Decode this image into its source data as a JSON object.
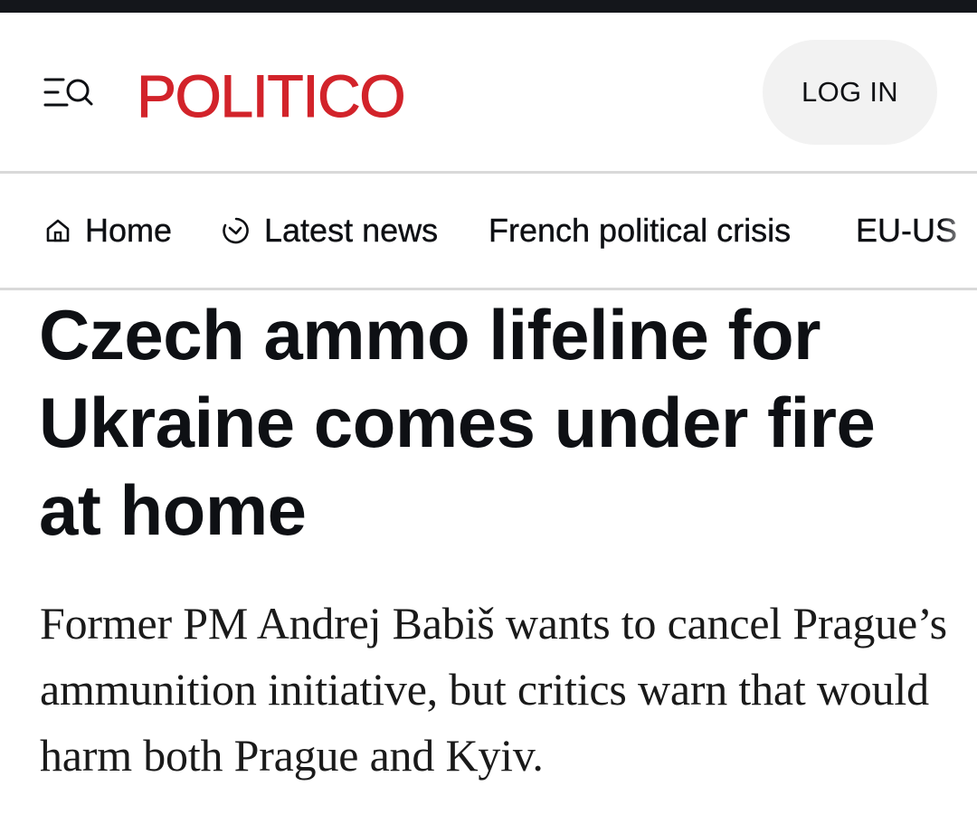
{
  "header": {
    "logo_text": "POLITICO",
    "brand_color": "#d2232a",
    "menu_icon": "menu-search-icon",
    "login_label": "LOG IN"
  },
  "nav": {
    "items": [
      {
        "label": "Home",
        "icon": "home-icon"
      },
      {
        "label": "Latest news",
        "icon": "clock-icon"
      },
      {
        "label": "French political crisis"
      },
      {
        "label": "EU-US"
      }
    ]
  },
  "article": {
    "headline": "Czech ammo lifeline for Ukraine comes under fire at home",
    "dek": "Former PM Andrej Babiš wants to cancel Prague’s ammunition initiative, but critics warn that would harm both Prague and Kyiv."
  }
}
